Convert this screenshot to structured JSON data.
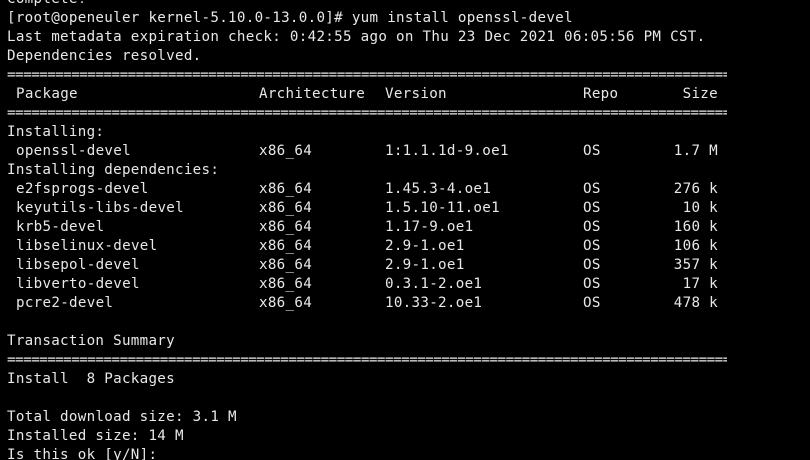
{
  "terminal": {
    "top_partial_line": "Complete!",
    "prompt_line": "[root@openeuler kernel-5.10.0-13.0.0]# yum install openssl-devel",
    "metadata_line": "Last metadata expiration check: 0:42:55 ago on Thu 23 Dec 2021 06:05:56 PM CST.",
    "deps_resolved_line": "Dependencies resolved.",
    "rule_char": "=",
    "headers": {
      "package": "Package",
      "architecture": "Architecture",
      "version": "Version",
      "repo": "Repo",
      "size": "Size"
    },
    "installing_label": "Installing:",
    "installing_packages": [
      {
        "package": "openssl-devel",
        "arch": "x86_64",
        "version": "1:1.1.1d-9.oe1",
        "repo": "OS",
        "size": "1.7 M"
      }
    ],
    "installing_deps_label": "Installing dependencies:",
    "dependency_packages": [
      {
        "package": "e2fsprogs-devel",
        "arch": "x86_64",
        "version": "1.45.3-4.oe1",
        "repo": "OS",
        "size": "276 k"
      },
      {
        "package": "keyutils-libs-devel",
        "arch": "x86_64",
        "version": "1.5.10-11.oe1",
        "repo": "OS",
        "size": "10 k"
      },
      {
        "package": "krb5-devel",
        "arch": "x86_64",
        "version": "1.17-9.oe1",
        "repo": "OS",
        "size": "160 k"
      },
      {
        "package": "libselinux-devel",
        "arch": "x86_64",
        "version": "2.9-1.oe1",
        "repo": "OS",
        "size": "106 k"
      },
      {
        "package": "libsepol-devel",
        "arch": "x86_64",
        "version": "2.9-1.oe1",
        "repo": "OS",
        "size": "357 k"
      },
      {
        "package": "libverto-devel",
        "arch": "x86_64",
        "version": "0.3.1-2.oe1",
        "repo": "OS",
        "size": "17 k"
      },
      {
        "package": "pcre2-devel",
        "arch": "x86_64",
        "version": "10.33-2.oe1",
        "repo": "OS",
        "size": "478 k"
      }
    ],
    "transaction_summary_label": "Transaction Summary",
    "install_count_line": "Install  8 Packages",
    "total_download_line": "Total download size: 3.1 M",
    "installed_size_line": "Installed size: 14 M",
    "bottom_partial_line": "Is this ok [y/N]:"
  }
}
